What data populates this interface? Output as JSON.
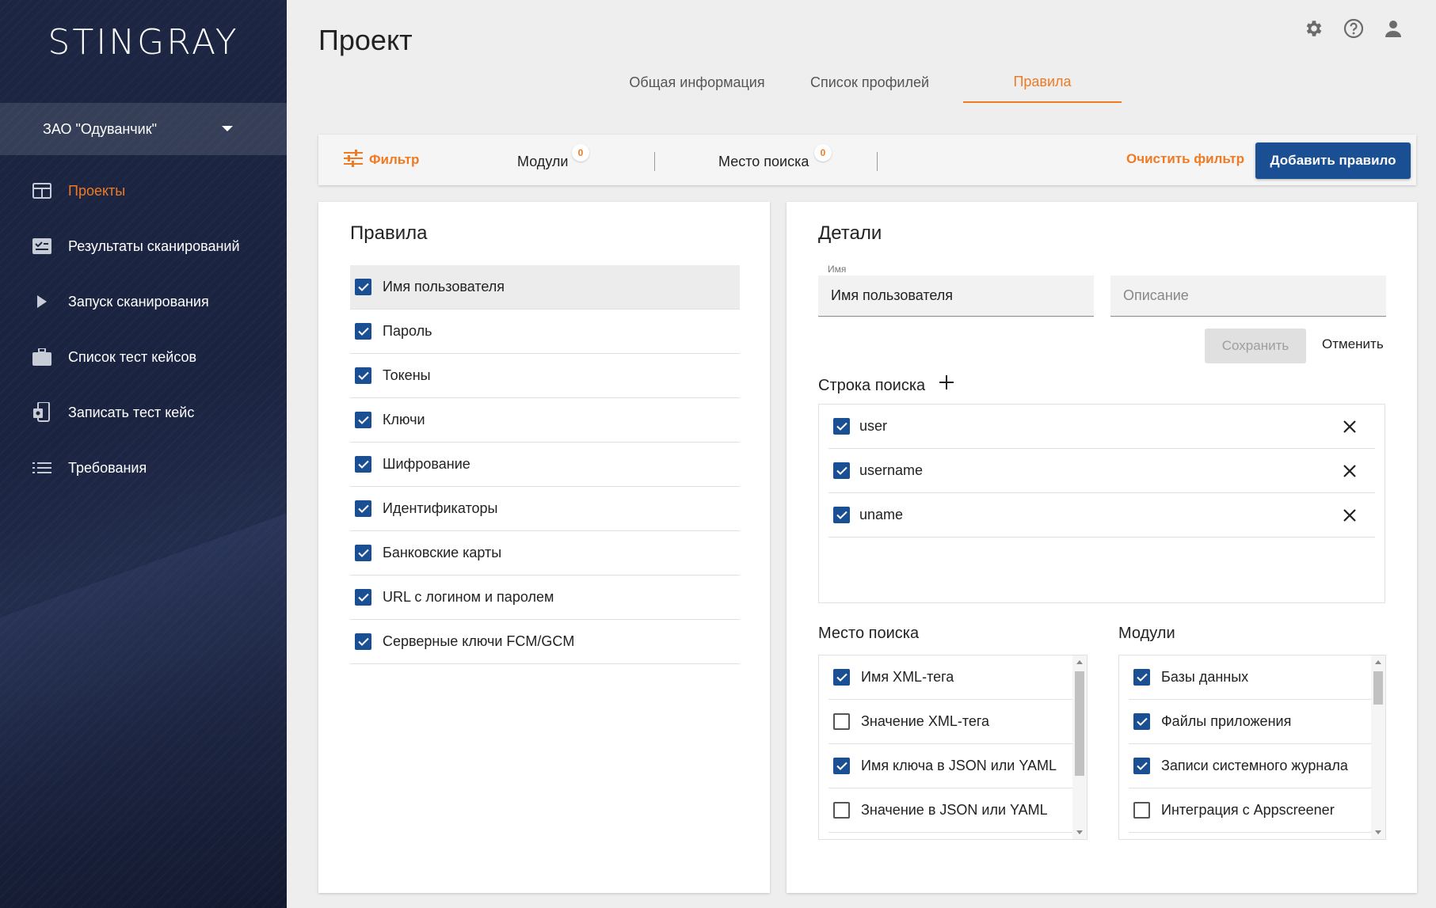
{
  "app": {
    "logo": "STINGRAY"
  },
  "org": {
    "name": "ЗАО \"Одуванчик\""
  },
  "sidebar": {
    "items": [
      {
        "label": "Проекты",
        "icon": "dashboard-icon"
      },
      {
        "label": "Результаты сканирований",
        "icon": "scan-results-icon"
      },
      {
        "label": "Запуск сканирования",
        "icon": "play-icon"
      },
      {
        "label": "Список тест кейсов",
        "icon": "briefcase-icon"
      },
      {
        "label": "Записать тест кейс",
        "icon": "record-device-icon"
      },
      {
        "label": "Требования",
        "icon": "list-icon"
      }
    ]
  },
  "header": {
    "title": "Проект",
    "tabs": [
      {
        "label": "Общая информация"
      },
      {
        "label": "Список профилей"
      },
      {
        "label": "Правила"
      }
    ]
  },
  "filterbar": {
    "filter_label": "Фильтр",
    "modules_label": "Модули",
    "modules_count": "0",
    "location_label": "Место поиска",
    "location_count": "0",
    "clear_label": "Очистить фильтр",
    "add_label": "Добавить правило"
  },
  "rules": {
    "title": "Правила",
    "items": [
      {
        "label": "Имя пользователя",
        "checked": true,
        "selected": true
      },
      {
        "label": "Пароль",
        "checked": true
      },
      {
        "label": "Токены",
        "checked": true
      },
      {
        "label": "Ключи",
        "checked": true
      },
      {
        "label": "Шифрование",
        "checked": true
      },
      {
        "label": "Идентификаторы",
        "checked": true
      },
      {
        "label": "Банковские карты",
        "checked": true
      },
      {
        "label": "URL с логином и паролем",
        "checked": true
      },
      {
        "label": "Серверные ключи FCM/GCM",
        "checked": true
      }
    ]
  },
  "details": {
    "title": "Детали",
    "name_label": "Имя",
    "name_value": "Имя пользователя",
    "description_placeholder": "Описание",
    "save_label": "Сохранить",
    "cancel_label": "Отменить",
    "search_string_label": "Строка поиска",
    "search_strings": [
      {
        "value": "user",
        "checked": true
      },
      {
        "value": "username",
        "checked": true
      },
      {
        "value": "uname",
        "checked": true
      }
    ],
    "location_label": "Место поиска",
    "locations": [
      {
        "label": "Имя XML-тега",
        "checked": true
      },
      {
        "label": "Значение XML-тега",
        "checked": false
      },
      {
        "label": "Имя ключа в JSON или YAML",
        "checked": true
      },
      {
        "label": "Значение в JSON или YAML",
        "checked": false
      }
    ],
    "modules_label": "Модули",
    "modules": [
      {
        "label": "Базы данных",
        "checked": true
      },
      {
        "label": "Файлы приложения",
        "checked": true
      },
      {
        "label": "Записи системного журнала",
        "checked": true
      },
      {
        "label": "Интеграция с Appscreener",
        "checked": false
      }
    ]
  },
  "colors": {
    "accent": "#f07a22",
    "primary": "#1a4f94"
  }
}
